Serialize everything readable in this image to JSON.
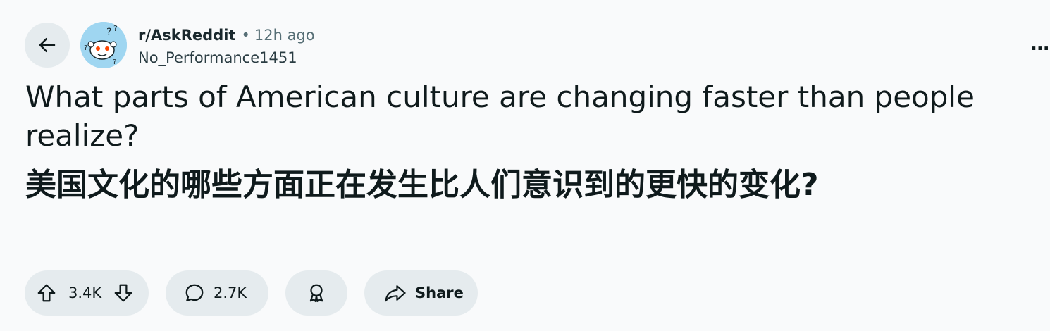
{
  "post": {
    "subreddit": "r/AskReddit",
    "separator": "•",
    "time_ago": "12h ago",
    "author": "No_Performance1451",
    "overflow_label": "...",
    "title": "What parts of American culture are changing faster than people realize?",
    "title_translation": "美国文化的哪些方面正在发生比人们意识到的更快的变化?"
  },
  "actions": {
    "vote_count": "3.4K",
    "comment_count": "2.7K",
    "share_label": "Share"
  },
  "icons": {
    "back": "arrow-left-icon",
    "upvote": "upvote-arrow-icon",
    "downvote": "downvote-arrow-icon",
    "comment": "speech-bubble-icon",
    "award": "award-ribbon-icon",
    "share": "share-arrow-icon"
  },
  "colors": {
    "page_bg": "#f9fafb",
    "pill_bg": "#e5ebee",
    "text": "#0f1a1c",
    "muted_text": "#576f76",
    "avatar_bg": "#9fd6f1"
  }
}
